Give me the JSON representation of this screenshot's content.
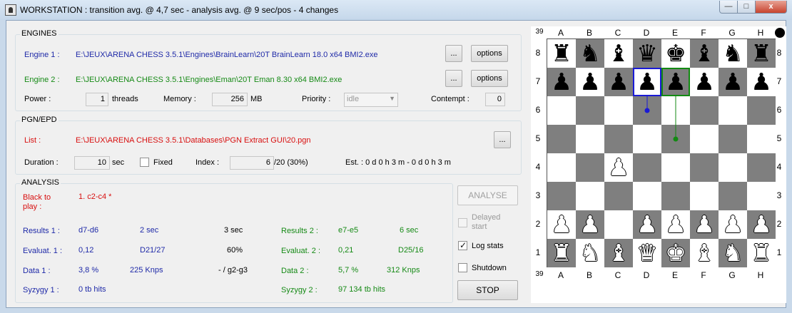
{
  "window": {
    "title": "WORKSTATION : transition avg. @ 4,7 sec - analysis avg. @ 9 sec/pos - 4 changes",
    "min_glyph": "—",
    "max_glyph": "□",
    "close_glyph": "x"
  },
  "engines": {
    "title": "ENGINES",
    "engine1_label": "Engine 1 :",
    "engine1_path": "E:\\JEUX\\ARENA CHESS 3.5.1\\Engines\\BrainLearn\\20T BrainLearn 18.0 x64 BMI2.exe",
    "engine2_label": "Engine 2 :",
    "engine2_path": "E:\\JEUX\\ARENA CHESS 3.5.1\\Engines\\Eman\\20T Eman 8.30 x64 BMI2.exe",
    "browse_label": "...",
    "options_label": "options",
    "power_label": "Power :",
    "threads_value": "1",
    "threads_unit": "threads",
    "memory_label": "Memory :",
    "memory_value": "256",
    "memory_unit": "MB",
    "priority_label": "Priority :",
    "priority_value": "idle",
    "contempt_label": "Contempt :",
    "contempt_value": "0"
  },
  "pgn": {
    "title": "PGN/EPD",
    "list_label": "List :",
    "list_path": "E:\\JEUX\\ARENA CHESS 3.5.1\\Databases\\PGN Extract GUI\\20.pgn",
    "browse_label": "...",
    "duration_label": "Duration :",
    "duration_value": "10",
    "duration_unit": "sec",
    "fixed_label": "Fixed",
    "index_label": "Index :",
    "index_value": "6",
    "index_total": "/20 (30%)",
    "est_text": "Est. : 0 d 0 h 3 m - 0 d 0 h 3 m"
  },
  "analysis": {
    "title": "ANALYSIS",
    "side_label": "Black to play :",
    "moves": "1. c2-c4 *",
    "results1_label": "Results 1 :",
    "results1_move": "d7-d6",
    "results1_time": "2 sec",
    "center_time": "3 sec",
    "results2_label": "Results 2 :",
    "results2_move": "e7-e5",
    "results2_time": "6 sec",
    "eval1_label": "Evaluat. 1 :",
    "eval1_value": "0,12",
    "eval1_depth": "D21/27",
    "center_percent": "60%",
    "eval2_label": "Evaluat. 2 :",
    "eval2_value": "0,21",
    "eval2_depth": "D25/16",
    "data1_label": "Data 1 :",
    "data1_value": "3,8 %",
    "data1_speed": "225 Knps",
    "center_move": "- / g2-g3",
    "data2_label": "Data 2 :",
    "data2_value": "5,7 %",
    "data2_speed": "312 Knps",
    "syzygy1_label": "Syzygy 1 :",
    "syzygy1_value": "0 tb hits",
    "syzygy2_label": "Syzygy 2 :",
    "syzygy2_value": "97 134 tb hits"
  },
  "controls": {
    "analyse_label": "ANALYSE",
    "delayed_start_label": "Delayed start",
    "log_stats_label": "Log stats",
    "shutdown_label": "Shutdown",
    "stop_label": "STOP"
  },
  "board": {
    "move_number": "39",
    "files": [
      "A",
      "B",
      "C",
      "D",
      "E",
      "F",
      "G",
      "H"
    ],
    "ranks": [
      "8",
      "7",
      "6",
      "5",
      "4",
      "3",
      "2",
      "1"
    ],
    "pieces": {
      "a8": "br",
      "b8": "bn",
      "c8": "bb",
      "d8": "bq",
      "e8": "bk",
      "f8": "bb",
      "g8": "bn",
      "h8": "br",
      "a7": "bp",
      "b7": "bp",
      "c7": "bp",
      "d7": "bp",
      "e7": "bp",
      "f7": "bp",
      "g7": "bp",
      "h7": "bp",
      "c4": "wp",
      "a2": "wp",
      "b2": "wp",
      "d2": "wp",
      "e2": "wp",
      "f2": "wp",
      "g2": "wp",
      "h2": "wp",
      "a1": "wr",
      "b1": "wn",
      "c1": "wb",
      "d1": "wq",
      "e1": "wk",
      "f1": "wb",
      "g1": "wn",
      "h1": "wr"
    },
    "arrows": [
      {
        "from": "d7",
        "to": "d6",
        "color": "#1a1ad6"
      },
      {
        "from": "e7",
        "to": "e5",
        "color": "#138a13"
      }
    ],
    "turn_color": "black"
  }
}
